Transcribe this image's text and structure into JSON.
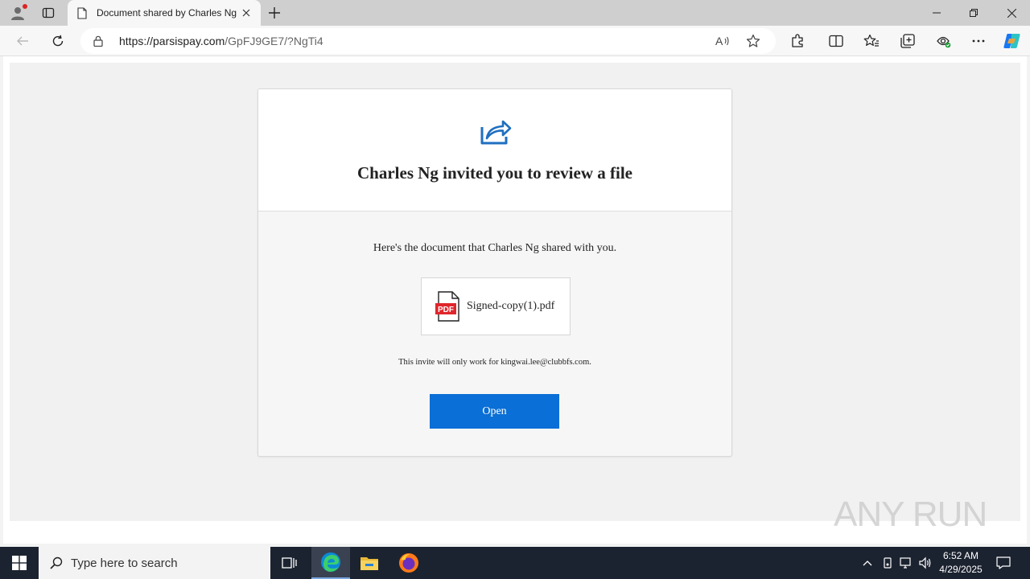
{
  "browser": {
    "tab_title": "Document shared by Charles Ng",
    "url_host": "https://parsispay.com",
    "url_path": "/GpFJ9GE7/?NgTi4"
  },
  "page": {
    "title": "Charles Ng invited you to review a file",
    "shared_text": "Here's the document that Charles Ng shared with you.",
    "file_name": "Signed-copy(1).pdf",
    "invite_note": "This invite will only work for kingwai.lee@clubbfs.com.",
    "open_button": "Open",
    "pdf_badge": "PDF"
  },
  "watermark": "ANY RUN",
  "taskbar": {
    "search_placeholder": "Type here to search",
    "time": "6:52 AM",
    "date": "4/29/2025"
  },
  "colors": {
    "accent": "#0a6fd6",
    "pdf_red": "#e0262b",
    "taskbar": "#1c2330"
  },
  "icons": [
    "profile-icon",
    "tab-actions-icon",
    "document-icon",
    "close-icon",
    "new-tab-icon",
    "minimize-icon",
    "restore-icon",
    "window-close-icon",
    "back-icon",
    "refresh-icon",
    "lock-icon",
    "read-aloud-icon",
    "favorite-star-icon",
    "extensions-icon",
    "split-screen-icon",
    "favorites-icon",
    "collections-icon",
    "performance-icon",
    "more-icon",
    "copilot-icon",
    "share-icon",
    "pdf-icon",
    "windows-start-icon",
    "search-icon",
    "task-view-icon",
    "edge-icon",
    "file-explorer-icon",
    "firefox-icon",
    "chevron-up-icon",
    "wifi-icon",
    "network-icon",
    "volume-icon",
    "notification-icon"
  ]
}
